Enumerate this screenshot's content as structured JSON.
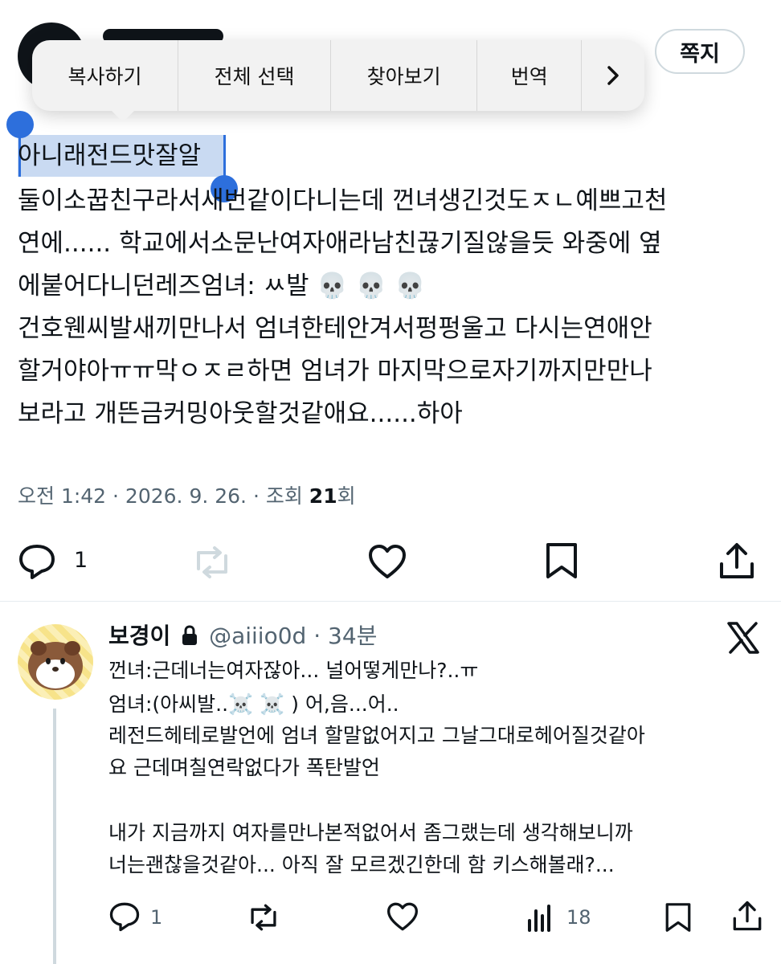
{
  "header": {
    "dm_label": "쪽지"
  },
  "context_menu": {
    "items": [
      "복사하기",
      "전체 선택",
      "찾아보기",
      "번역"
    ],
    "more_icon": "chevron-right-icon"
  },
  "tweet": {
    "selected_text": "아니래전드맛잘알",
    "lines": [
      "둘이소꿉친구라서새번같이다니는데 껀녀생긴것도ㅈㄴ예쁘고천",
      "연에...... 학교에서소문난여자애라남친끊기질않을듯 와중에 옆",
      "에붙어다니던레즈엄녀: ㅆ발 💀 💀 💀",
      "건호웬씨발새끼만나서 엄녀한테안겨서펑펑울고 다시는연애안",
      "할거야아ㅠㅠ막ㅇㅈㄹ하면 엄녀가 마지막으로자기까지만만나",
      "보라고 개뜬금커밍아웃할것같애요......하아"
    ],
    "meta_prefix": "오전 1:42 · 2026. 9. 26. · 조회 ",
    "views": "21",
    "meta_suffix": "회",
    "reply_count": "1"
  },
  "reply": {
    "name": "보경이",
    "handle": "@aiiio0d",
    "time": "· 34분",
    "lines": [
      "껀녀:근데너는여자잖아... 널어떻게만나?..ㅠ",
      "엄녀:(아씨발..☠️ ☠️ ) 어,음...어..",
      "레전드헤테로발언에 엄녀 할말없어지고 그날그대로헤어질것같아",
      "요 근데며칠연락없다가 폭탄발언",
      "",
      "내가 지금까지 여자를만나본적없어서 좀그랬는데 생각해보니까",
      "너는괜찮을것같아... 아직 잘 모르겠긴한데 함 키스해볼래?..."
    ],
    "reply_count": "1",
    "view_count": "18"
  },
  "colors": {
    "selection": "#c9daf2",
    "handle": "#2d6fdc",
    "secondary_text": "#536471"
  }
}
